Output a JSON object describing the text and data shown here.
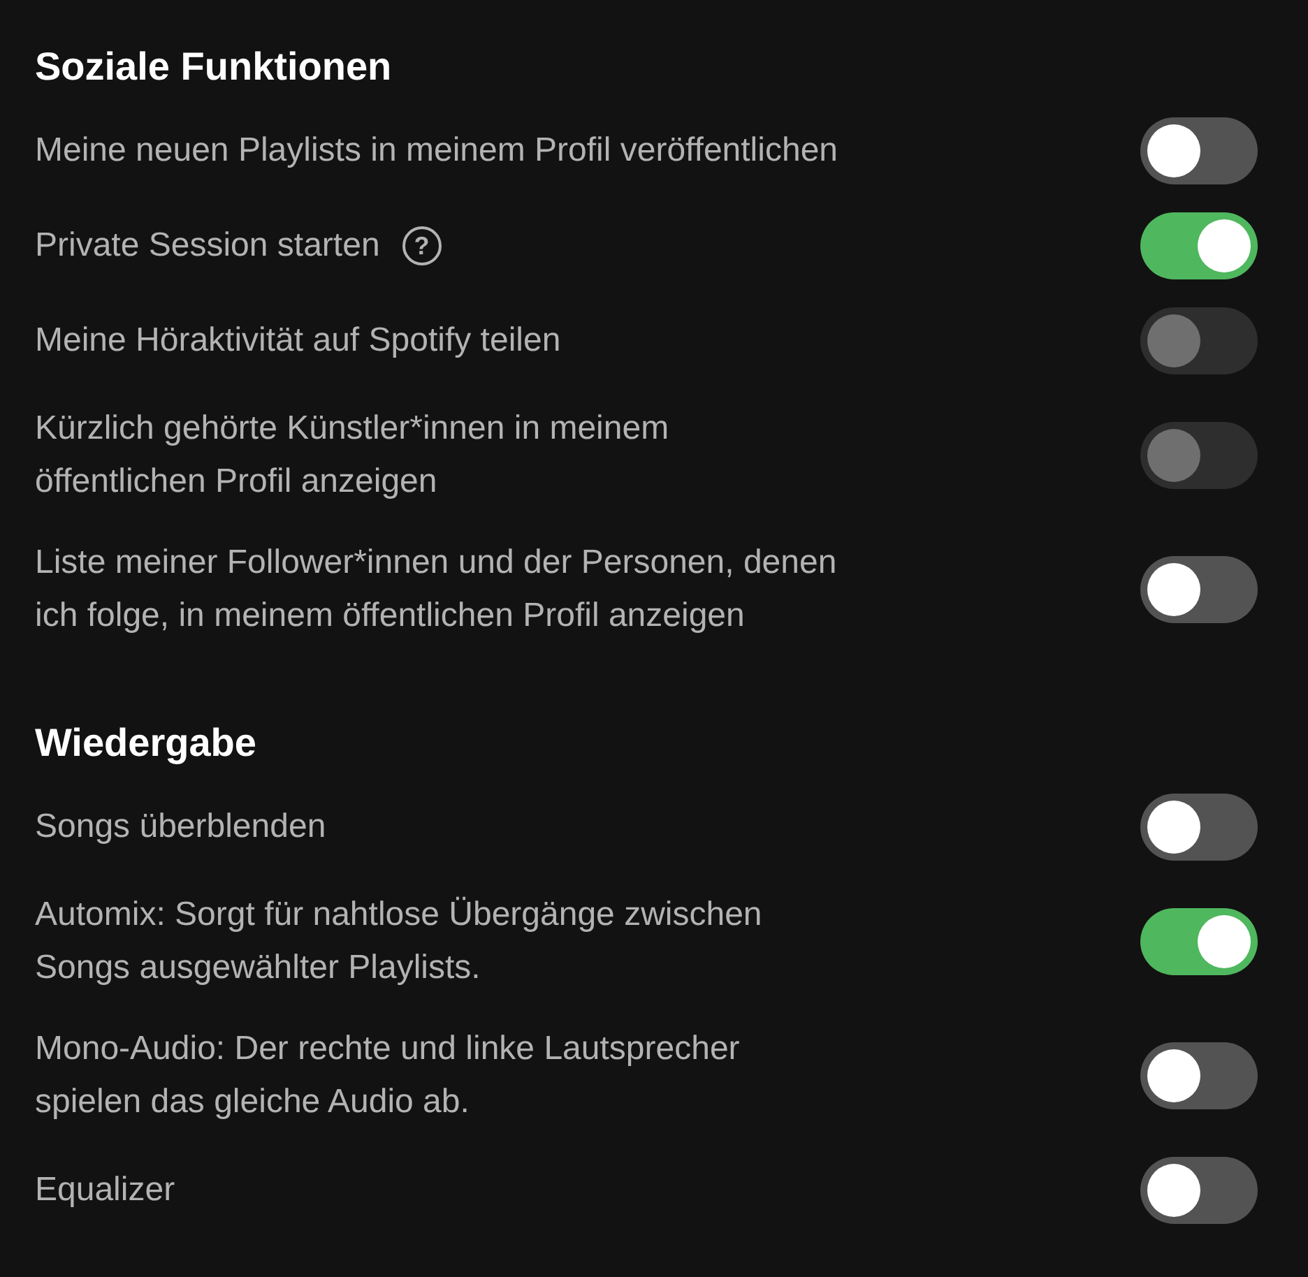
{
  "sections": [
    {
      "title": "Soziale Funktionen",
      "items": [
        {
          "label": "Meine neuen Playlists in meinem Profil veröffentlichen",
          "on": false,
          "disabled": false
        },
        {
          "label": "Private Session starten",
          "help": "?",
          "on": true,
          "disabled": false
        },
        {
          "label": "Meine Höraktivität auf Spotify teilen",
          "on": false,
          "disabled": true
        },
        {
          "label": "Kürzlich gehörte Künstler*innen in meinem öffentlichen Profil anzeigen",
          "on": false,
          "disabled": true
        },
        {
          "label": "Liste meiner Follower*innen und der Personen, denen ich folge, in meinem öffentlichen Profil anzeigen",
          "on": false,
          "disabled": false
        }
      ]
    },
    {
      "title": "Wiedergabe",
      "items": [
        {
          "label": "Songs überblenden",
          "on": false,
          "disabled": false
        },
        {
          "label": "Automix: Sorgt für nahtlose Übergänge zwischen Songs ausgewählter Playlists.",
          "on": true,
          "disabled": false
        },
        {
          "label": "Mono-Audio: Der rechte und linke Lautsprecher spielen das gleiche Audio ab.",
          "on": false,
          "disabled": false
        },
        {
          "label": "Equalizer",
          "on": false,
          "disabled": false
        }
      ]
    }
  ]
}
